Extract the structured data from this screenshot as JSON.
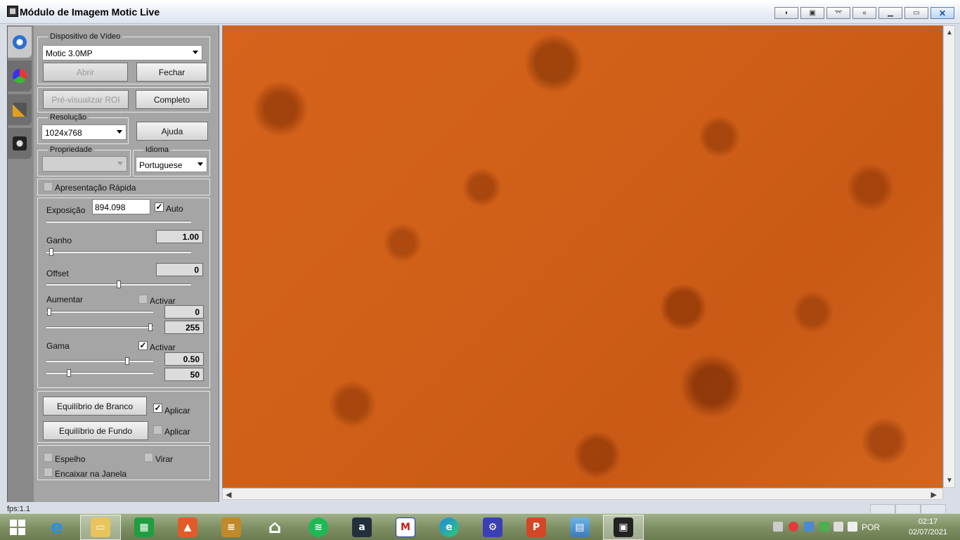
{
  "window": {
    "title": "Módulo de Imagem Motic Live",
    "controls": [
      "display-toggle-icon",
      "camera-icon",
      "glasses-icon",
      "collapse-icon",
      "minimize-icon",
      "maximize-icon",
      "close-icon"
    ]
  },
  "tabs": [
    {
      "name": "capture-settings-icon"
    },
    {
      "name": "color-settings-icon"
    },
    {
      "name": "tools-icon"
    },
    {
      "name": "camera-snapshot-icon"
    }
  ],
  "video_device": {
    "group_label": "Dispositivo de Vídeo",
    "device": "Motic 3.0MP",
    "open_label": "Abrir",
    "close_label": "Fechar",
    "roi_label": "Pré-visualizar ROI",
    "full_label": "Completo",
    "resolution_label": "Resolução",
    "resolution": "1024x768",
    "help_label": "Ajuda",
    "property_label": "Propriedade",
    "property": "",
    "language_label": "Idioma",
    "language": "Portuguese"
  },
  "quick_preview": {
    "label": "Apresentação Rápida",
    "checked": false
  },
  "exposure": {
    "label": "Exposição",
    "value": "894.098",
    "auto_label": "Auto",
    "auto_checked": true,
    "gain_label": "Ganho",
    "gain": "1.00",
    "gain_level": 0.02,
    "offset_label": "Offset",
    "offset": "0",
    "offset_level": 0.5,
    "enhance_label": "Aumentar",
    "enhance_activate_label": "Activar",
    "enhance_checked": false,
    "enhance_low": "0",
    "enhance_high": "255",
    "gamma_label": "Gama",
    "gamma_activate_label": "Activar",
    "gamma_checked": true,
    "gamma_value": "0.50",
    "gamma_second": "50"
  },
  "balance": {
    "white_label": "Equilíbrio de Branco",
    "white_apply_label": "Aplicar",
    "white_apply_checked": true,
    "background_label": "Equilíbrio de Fundo",
    "background_apply_label": "Aplicar",
    "background_apply_checked": false
  },
  "flip": {
    "mirror_label": "Espelho",
    "flip_label": "Virar",
    "fit_label": "Encaixar na Janela"
  },
  "status": {
    "fps": "fps:1.1"
  },
  "taskbar": {
    "apps": [
      "start-icon",
      "internet-explorer-icon",
      "file-explorer-icon",
      "store-icon",
      "photos-icon",
      "notes-icon",
      "home-icon",
      "spotify-icon",
      "amazon-icon",
      "motic-icon",
      "edge-icon",
      "settings-icon",
      "powerpoint-icon",
      "image-viewer-icon",
      "motic-live-icon"
    ],
    "language": "POR",
    "time": "02:17",
    "date": "02/07/2021"
  }
}
